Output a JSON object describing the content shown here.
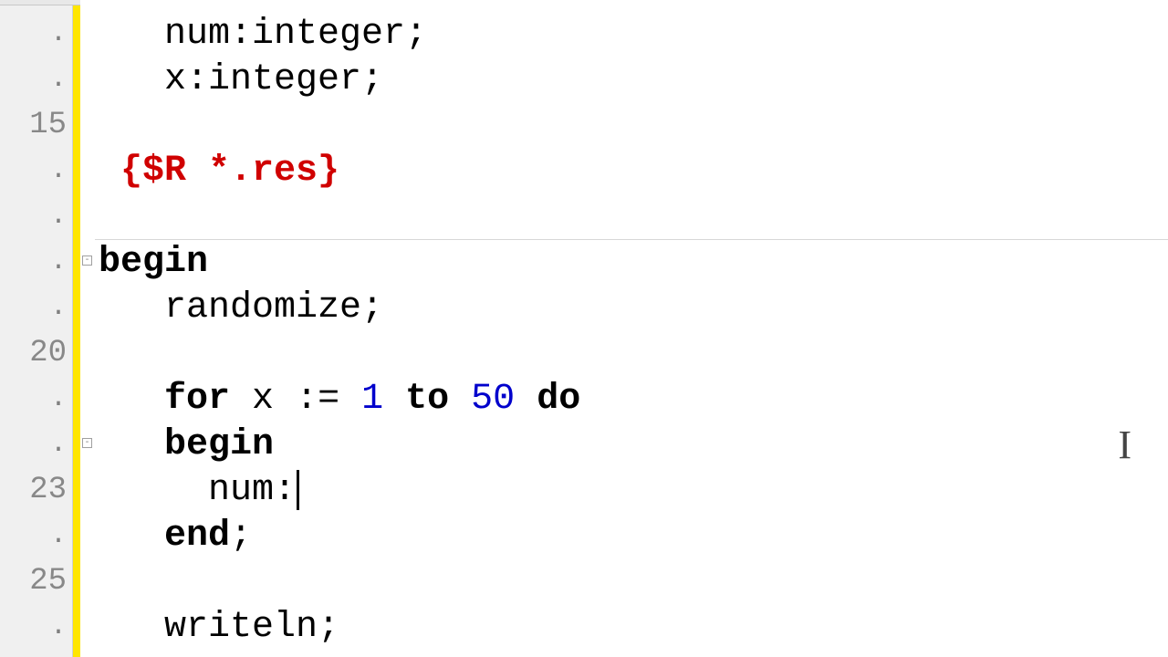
{
  "gutter": {
    "marks": [
      ".",
      ".",
      "15",
      ".",
      ".",
      ".",
      ".",
      "20",
      ".",
      ".",
      "23",
      ".",
      "25",
      "."
    ]
  },
  "code": {
    "l0": {
      "indent": "   ",
      "t": "num:integer;"
    },
    "l1": {
      "indent": "   ",
      "t": "x:integer;"
    },
    "l2": {
      "indent": "",
      "t": ""
    },
    "l3": {
      "indent": " ",
      "t": "{$R *.res}"
    },
    "l4": {
      "indent": "",
      "t": ""
    },
    "l5": {
      "kw": "begin"
    },
    "l6": {
      "indent": "   ",
      "t": "randomize;"
    },
    "l7": {
      "indent": "",
      "t": ""
    },
    "l8": {
      "indent": "   ",
      "kw_for": "for",
      "sp1": " ",
      "var": "x",
      "sp2": " ",
      "assign": ":=",
      "sp3": " ",
      "n1": "1",
      "sp4": " ",
      "kw_to": "to",
      "sp5": " ",
      "n2": "50",
      "sp6": " ",
      "kw_do": "do"
    },
    "l9": {
      "indent": "   ",
      "kw": "begin"
    },
    "l10": {
      "indent": "     ",
      "t": "num:"
    },
    "l11": {
      "indent": "   ",
      "kw": "end",
      "tail": ";"
    },
    "l12": {
      "indent": "",
      "t": ""
    },
    "l13": {
      "indent": "   ",
      "t": "writeln;"
    }
  }
}
